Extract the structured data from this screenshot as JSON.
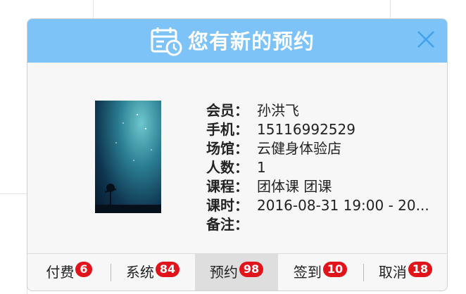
{
  "popup": {
    "title": "您有新的预约",
    "header_icon": "calendar-clock-icon",
    "close_icon": "close-icon",
    "accent_color": "#7ec3f7"
  },
  "member": {
    "fields": [
      {
        "label": "会员：",
        "value": "孙洪飞"
      },
      {
        "label": "手机：",
        "value": "15116992529"
      },
      {
        "label": "场馆：",
        "value": "云健身体验店"
      },
      {
        "label": "人数：",
        "value": "1"
      },
      {
        "label": "课程：",
        "value": "团体课 团课"
      },
      {
        "label": "课时：",
        "value": "2016-08-31 19:00 - 20..."
      },
      {
        "label": "备注：",
        "value": ""
      }
    ]
  },
  "footer": {
    "tabs": [
      {
        "label": "付费",
        "badge": "6"
      },
      {
        "label": "系统",
        "badge": "84"
      },
      {
        "label": "预约",
        "badge": "98"
      },
      {
        "label": "签到",
        "badge": "10"
      },
      {
        "label": "取消",
        "badge": "18"
      }
    ],
    "badge_color": "#e2141b",
    "active_tab_color": "#dedede"
  }
}
